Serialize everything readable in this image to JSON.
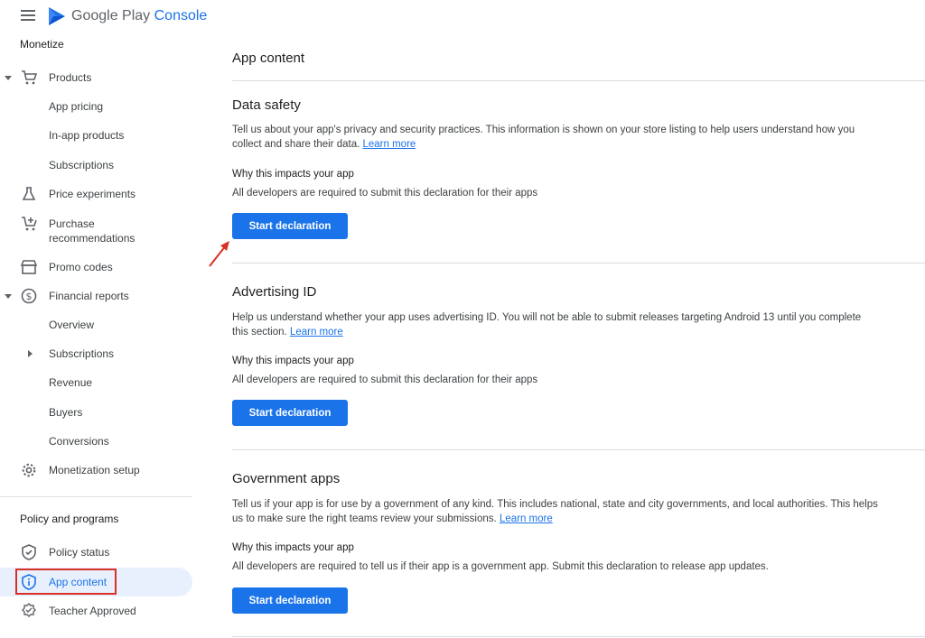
{
  "app": {
    "brand_prefix": "Google Play",
    "brand_accent": "Console"
  },
  "sidebar": {
    "monetize_title": "Monetize",
    "items": [
      {
        "label": "Products"
      },
      {
        "label": "App pricing"
      },
      {
        "label": "In-app products"
      },
      {
        "label": "Subscriptions"
      },
      {
        "label": "Price experiments"
      },
      {
        "label": "Purchase recommendations"
      },
      {
        "label": "Promo codes"
      },
      {
        "label": "Financial reports"
      },
      {
        "label": "Overview"
      },
      {
        "label": "Subscriptions"
      },
      {
        "label": "Revenue"
      },
      {
        "label": "Buyers"
      },
      {
        "label": "Conversions"
      },
      {
        "label": "Monetization setup"
      }
    ],
    "policy_title": "Policy and programs",
    "policy_items": [
      {
        "label": "Policy status"
      },
      {
        "label": "App content",
        "active": true
      },
      {
        "label": "Teacher Approved"
      }
    ]
  },
  "main": {
    "title": "App content",
    "sections": [
      {
        "title": "Data safety",
        "desc_line1": "Tell us about your app's privacy and security practices. This information is shown on your store listing to help users understand how you",
        "desc_line2": "collect and share their data.",
        "link": "Learn more",
        "why_title": "Why this impacts your app",
        "why_desc": "All developers are required to submit this declaration for their apps",
        "button": "Start declaration"
      },
      {
        "title": "Advertising ID",
        "desc_line1": "Help us understand whether your app uses advertising ID. You will not be able to submit releases targeting Android 13 until you complete",
        "desc_line2": "this section.",
        "link": "Learn more",
        "why_title": "Why this impacts your app",
        "why_desc": "All developers are required to submit this declaration for their apps",
        "button": "Start declaration"
      },
      {
        "title": "Government apps",
        "desc_line1": "Tell us if your app is for use by a government of any kind. This includes national, state and city governments, and local authorities. This helps",
        "desc_line2": "us to make sure the right teams review your submissions.",
        "link": "Learn more",
        "why_title": "Why this impacts your app",
        "why_desc": "All developers are required to tell us if their app is a government app. Submit this declaration to release app updates.",
        "button": "Start declaration"
      }
    ]
  },
  "colors": {
    "accent": "#1a73e8",
    "highlight": "#d93025",
    "active_bg": "#e8f0fe"
  }
}
